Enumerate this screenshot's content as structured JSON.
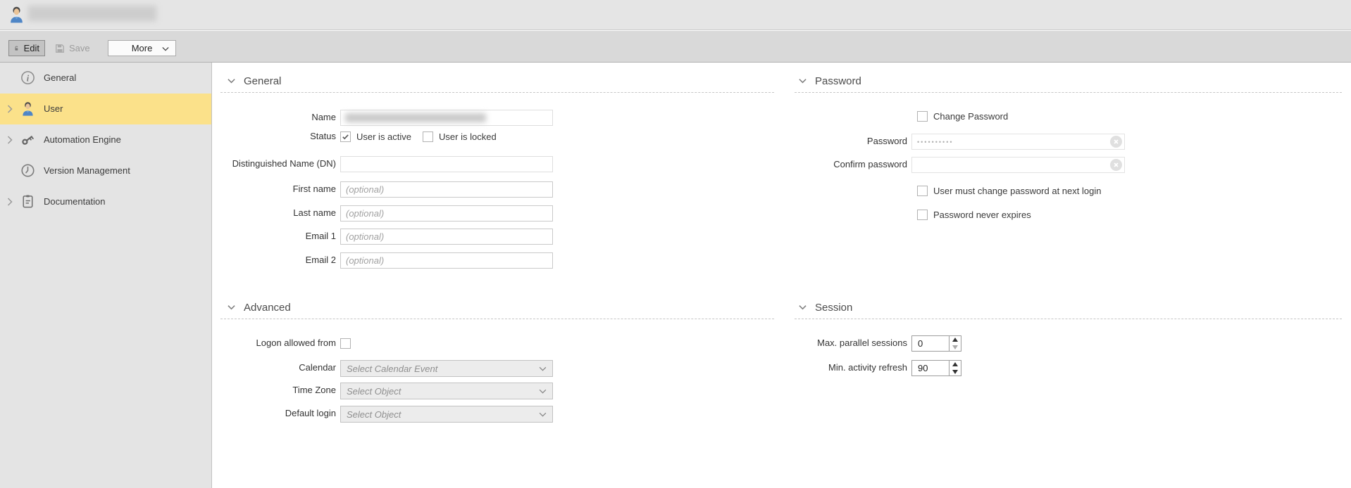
{
  "titlebar": {
    "title_redacted": true
  },
  "toolbar": {
    "edit_label": "Edit",
    "save_label": "Save",
    "more_label": "More"
  },
  "sidebar": {
    "selected_color": "#fbe18a",
    "items": [
      {
        "label": "General",
        "icon": "info-icon",
        "expandable": false,
        "selected": false
      },
      {
        "label": "User",
        "icon": "user-icon",
        "expandable": true,
        "selected": true
      },
      {
        "label": "Automation Engine",
        "icon": "key-icon",
        "expandable": true,
        "selected": false
      },
      {
        "label": "Version Management",
        "icon": "clock-icon",
        "expandable": false,
        "selected": false
      },
      {
        "label": "Documentation",
        "icon": "clipboard-icon",
        "expandable": true,
        "selected": false
      }
    ]
  },
  "sections": {
    "general": {
      "title": "General",
      "name_label": "Name",
      "name_value_redacted": true,
      "status_label": "Status",
      "user_is_active_label": "User is active",
      "user_is_active_checked": true,
      "user_is_locked_label": "User is locked",
      "user_is_locked_checked": false,
      "dn_label": "Distinguished Name (DN)",
      "dn_value": "",
      "first_name_label": "First name",
      "last_name_label": "Last name",
      "email1_label": "Email 1",
      "email2_label": "Email 2",
      "optional_placeholder": "(optional)"
    },
    "password": {
      "title": "Password",
      "change_password_label": "Change Password",
      "change_password_checked": false,
      "password_label": "Password",
      "password_masked_value": "••••••••••",
      "confirm_label": "Confirm password",
      "confirm_value": "",
      "must_change_label": "User must change password at next login",
      "must_change_checked": false,
      "never_expires_label": "Password never expires",
      "never_expires_checked": false
    },
    "advanced": {
      "title": "Advanced",
      "logon_allowed_label": "Logon allowed from",
      "logon_allowed_checked": false,
      "calendar_label": "Calendar",
      "calendar_placeholder": "Select Calendar Event",
      "timezone_label": "Time Zone",
      "timezone_placeholder": "Select Object",
      "default_login_label": "Default login",
      "default_login_placeholder": "Select Object"
    },
    "session": {
      "title": "Session",
      "max_sessions_label": "Max. parallel sessions",
      "max_sessions_value": "0",
      "min_refresh_label": "Min. activity refresh",
      "min_refresh_value": "90"
    }
  }
}
